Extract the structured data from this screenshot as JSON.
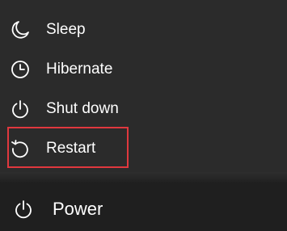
{
  "power_menu": {
    "items": [
      {
        "label": "Sleep",
        "icon": "moon-icon"
      },
      {
        "label": "Hibernate",
        "icon": "clock-icon"
      },
      {
        "label": "Shut down",
        "icon": "power-icon"
      },
      {
        "label": "Restart",
        "icon": "restart-icon"
      }
    ],
    "highlighted_item": "Restart",
    "highlight_color": "#e0383e"
  },
  "power_button": {
    "label": "Power",
    "icon": "power-icon"
  },
  "colors": {
    "panel_background": "#2b2b2b",
    "background": "#1f1f1f",
    "text": "#ffffff"
  }
}
